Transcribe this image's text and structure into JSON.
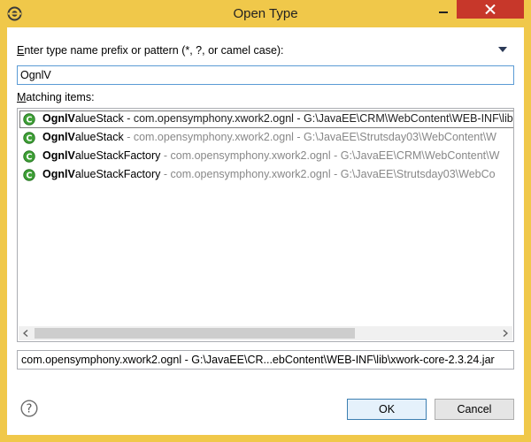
{
  "window": {
    "title": "Open Type"
  },
  "prompt": {
    "mnemonic": "E",
    "rest": "nter type name prefix or pattern (*, ?, or camel case):"
  },
  "filter": {
    "value": "OgnlV"
  },
  "matching": {
    "mnemonic": "M",
    "rest": "atching items:"
  },
  "items": [
    {
      "match": "OgnlV",
      "rest": "alueStack",
      "qualifier": " - com.opensymphony.xwork2.ognl - G:\\JavaEE\\CRM\\WebContent\\WEB-INF\\lib",
      "selected": true
    },
    {
      "match": "OgnlV",
      "rest": "alueStack",
      "qualifier": " - com.opensymphony.xwork2.ognl - G:\\JavaEE\\Strutsday03\\WebContent\\W",
      "selected": false
    },
    {
      "match": "OgnlV",
      "rest": "alueStackFactory",
      "qualifier": " - com.opensymphony.xwork2.ognl - G:\\JavaEE\\CRM\\WebContent\\W",
      "selected": false
    },
    {
      "match": "OgnlV",
      "rest": "alueStackFactory",
      "qualifier": " - com.opensymphony.xwork2.ognl - G:\\JavaEE\\Strutsday03\\WebCo",
      "selected": false
    }
  ],
  "status": {
    "text": "com.opensymphony.xwork2.ognl - G:\\JavaEE\\CR...ebContent\\WEB-INF\\lib\\xwork-core-2.3.24.jar"
  },
  "buttons": {
    "ok": "OK",
    "cancel": "Cancel"
  },
  "icons": {
    "class_icon": "class-icon",
    "help_icon": "help-icon",
    "view_menu_icon": "view-menu-icon",
    "close_icon": "close-icon",
    "minimize_icon": "minimize-icon",
    "app_icon": "eclipse-icon"
  },
  "colors": {
    "title_bar": "#f0c84a",
    "close_button": "#c7372a",
    "class_icon": "#3fa037",
    "focus_border": "#5b9bd5"
  }
}
